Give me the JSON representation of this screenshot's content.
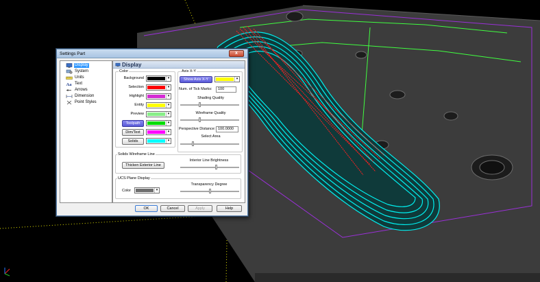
{
  "scene": {
    "colors": {
      "background": "#000000",
      "stock_top": "#3c3c3c",
      "stock_side": "#2a2a2a",
      "toolpath": "#00f0f0",
      "rapid": "#ff2020",
      "boundary": "#9b30d9",
      "axis": "#e0e000",
      "guide": "#40ff40"
    }
  },
  "dialog": {
    "title": "Settings Part",
    "close_label": "x",
    "tree": [
      {
        "label": "Display",
        "icon": "display-icon",
        "selected": true
      },
      {
        "label": "System",
        "icon": "system-icon"
      },
      {
        "label": "Units",
        "icon": "units-icon"
      },
      {
        "label": "Text",
        "icon": "text-icon"
      },
      {
        "label": "Arrows",
        "icon": "arrows-icon"
      },
      {
        "label": "Dimension",
        "icon": "dimension-icon"
      },
      {
        "label": "Point Styles",
        "icon": "point-styles-icon"
      }
    ],
    "panel_title": "Display",
    "color_group": {
      "label": "Color",
      "rows": [
        {
          "label": "Background",
          "color": "#000000"
        },
        {
          "label": "Selection",
          "color": "#ff0000"
        },
        {
          "label": "Highlight",
          "color": "#d42bd4"
        },
        {
          "label": "Entity",
          "color": "#ffff00"
        },
        {
          "label": "Preview",
          "color": "#88ee88"
        },
        {
          "label": "Toolpath",
          "color": "#00dd00",
          "button": true,
          "active": true
        },
        {
          "label": "Dim/Text",
          "color": "#ff00ff",
          "button": true
        },
        {
          "label": "Solids",
          "color": "#00ffff",
          "button": true
        }
      ]
    },
    "axis_group": {
      "label": "Axis X-Y",
      "show_axis_label": "Show Axis X-Y",
      "axis_color": "#ffff00",
      "tick_marks_label": "Num. of Tick Marks:",
      "tick_marks_value": "100",
      "shading_label": "Shading Quality",
      "shading_level": 0.33,
      "wireframe_label": "Wireframe Quality",
      "wireframe_level": 0.33,
      "perspective_label": "Perspective Distance:",
      "perspective_value": "100.0000",
      "select_area_label": "Select Area",
      "select_area_level": 0.2
    },
    "solids_group": {
      "label": "Solids Wireframe Line",
      "thicken_label": "Thicken Exterior Line",
      "brightness_label": "Interior Line Brightness",
      "brightness_level": 0.62
    },
    "ucs_group": {
      "label": "UCS Plane Display",
      "color_label": "Color",
      "color": "#6e6e6e",
      "transparency_label": "Transparency Degree",
      "transparency_level": 0.5
    },
    "buttons": {
      "ok": "OK",
      "cancel": "Cancel",
      "apply": "Apply",
      "help": "Help"
    }
  }
}
